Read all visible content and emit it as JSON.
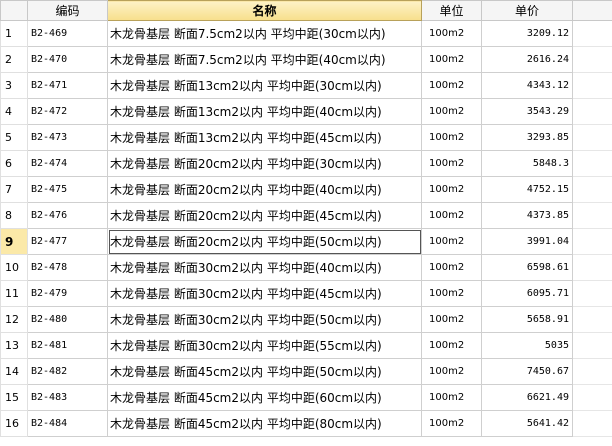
{
  "headers": {
    "rownum": "",
    "code": "编码",
    "name": "名称",
    "unit": "单位",
    "price": "单价"
  },
  "active_row": 9,
  "rows": [
    {
      "num": "1",
      "code": "B2-469",
      "name": "木龙骨基层 断面7.5cm2以内 平均中距(30cm以内)",
      "unit": "100m2",
      "price": "3209.12"
    },
    {
      "num": "2",
      "code": "B2-470",
      "name": "木龙骨基层 断面7.5cm2以内 平均中距(40cm以内)",
      "unit": "100m2",
      "price": "2616.24"
    },
    {
      "num": "3",
      "code": "B2-471",
      "name": "木龙骨基层 断面13cm2以内 平均中距(30cm以内)",
      "unit": "100m2",
      "price": "4343.12"
    },
    {
      "num": "4",
      "code": "B2-472",
      "name": "木龙骨基层 断面13cm2以内 平均中距(40cm以内)",
      "unit": "100m2",
      "price": "3543.29"
    },
    {
      "num": "5",
      "code": "B2-473",
      "name": "木龙骨基层 断面13cm2以内 平均中距(45cm以内)",
      "unit": "100m2",
      "price": "3293.85"
    },
    {
      "num": "6",
      "code": "B2-474",
      "name": "木龙骨基层 断面20cm2以内 平均中距(30cm以内)",
      "unit": "100m2",
      "price": "5848.3"
    },
    {
      "num": "7",
      "code": "B2-475",
      "name": "木龙骨基层 断面20cm2以内 平均中距(40cm以内)",
      "unit": "100m2",
      "price": "4752.15"
    },
    {
      "num": "8",
      "code": "B2-476",
      "name": "木龙骨基层 断面20cm2以内 平均中距(45cm以内)",
      "unit": "100m2",
      "price": "4373.85"
    },
    {
      "num": "9",
      "code": "B2-477",
      "name": "木龙骨基层 断面20cm2以内 平均中距(50cm以内)",
      "unit": "100m2",
      "price": "3991.04"
    },
    {
      "num": "10",
      "code": "B2-478",
      "name": "木龙骨基层 断面30cm2以内 平均中距(40cm以内)",
      "unit": "100m2",
      "price": "6598.61"
    },
    {
      "num": "11",
      "code": "B2-479",
      "name": "木龙骨基层 断面30cm2以内 平均中距(45cm以内)",
      "unit": "100m2",
      "price": "6095.71"
    },
    {
      "num": "12",
      "code": "B2-480",
      "name": "木龙骨基层 断面30cm2以内 平均中距(50cm以内)",
      "unit": "100m2",
      "price": "5658.91"
    },
    {
      "num": "13",
      "code": "B2-481",
      "name": "木龙骨基层 断面30cm2以内 平均中距(55cm以内)",
      "unit": "100m2",
      "price": "5035"
    },
    {
      "num": "14",
      "code": "B2-482",
      "name": "木龙骨基层 断面45cm2以内 平均中距(50cm以内)",
      "unit": "100m2",
      "price": "7450.67"
    },
    {
      "num": "15",
      "code": "B2-483",
      "name": "木龙骨基层 断面45cm2以内 平均中距(60cm以内)",
      "unit": "100m2",
      "price": "6621.49"
    },
    {
      "num": "16",
      "code": "B2-484",
      "name": "木龙骨基层 断面45cm2以内 平均中距(80cm以内)",
      "unit": "100m2",
      "price": "5641.42"
    }
  ]
}
